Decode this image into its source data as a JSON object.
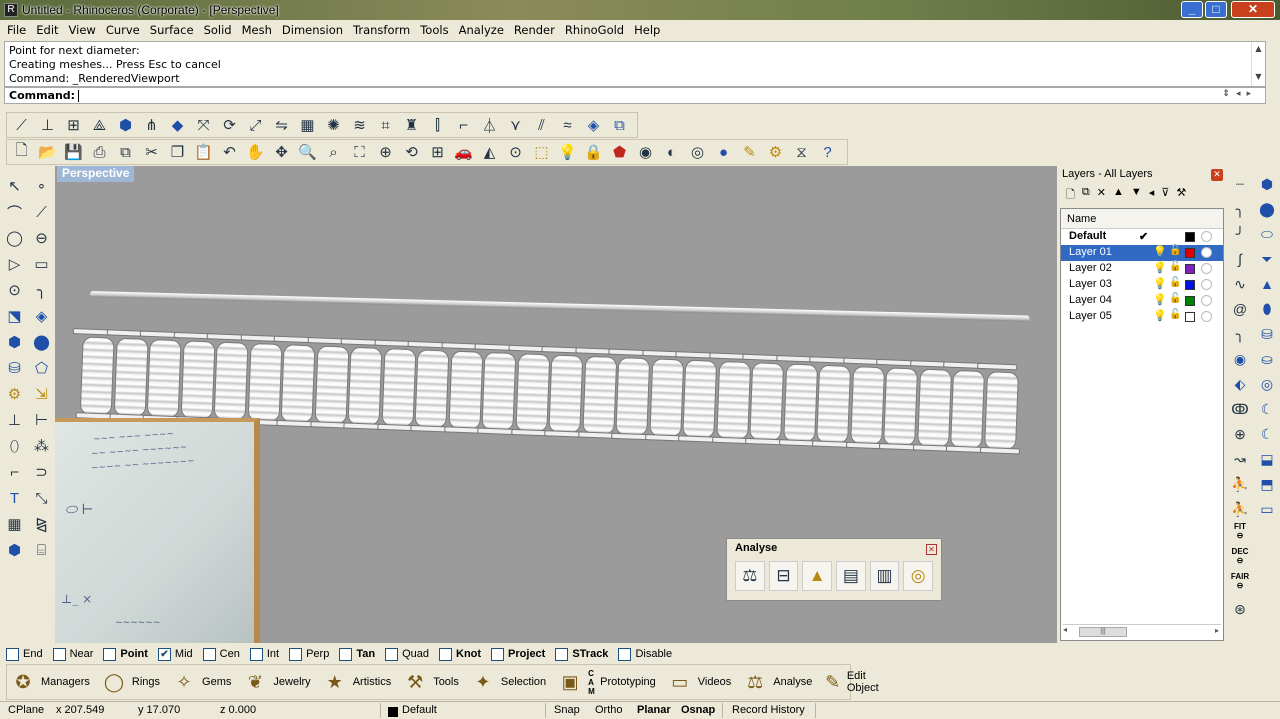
{
  "window": {
    "title": "Untitled - Rhinoceros (Corporate) - [Perspective]"
  },
  "menu": [
    "File",
    "Edit",
    "View",
    "Curve",
    "Surface",
    "Solid",
    "Mesh",
    "Dimension",
    "Transform",
    "Tools",
    "Analyze",
    "Render",
    "RhinoGold",
    "Help"
  ],
  "history": [
    "Point for next diameter:",
    "Creating meshes... Press Esc to cancel",
    "Command: _RenderedViewport"
  ],
  "command": {
    "label": "Command:",
    "value": ""
  },
  "viewport": {
    "label": "Perspective",
    "background": "#9b9b9b"
  },
  "analyse_panel": {
    "title": "Analyse",
    "icons": [
      "scale-icon",
      "weigh-icon",
      "gold-bars-icon",
      "report-icon",
      "report-save-icon",
      "measure-ring-icon"
    ]
  },
  "layers": {
    "title": "Layers - All Layers",
    "column": "Name",
    "rows": [
      {
        "name": "Default",
        "current": true,
        "color": "#000000"
      },
      {
        "name": "Layer 01",
        "selected": true,
        "color": "#e00000"
      },
      {
        "name": "Layer 02",
        "color": "#8020c0"
      },
      {
        "name": "Layer 03",
        "color": "#0010e0"
      },
      {
        "name": "Layer 04",
        "color": "#008000"
      },
      {
        "name": "Layer 05",
        "color": "#ffffff"
      }
    ]
  },
  "osnap": [
    {
      "label": "End",
      "checked": false,
      "bold": false
    },
    {
      "label": "Near",
      "checked": false,
      "bold": false
    },
    {
      "label": "Point",
      "checked": false,
      "bold": true
    },
    {
      "label": "Mid",
      "checked": true,
      "bold": false
    },
    {
      "label": "Cen",
      "checked": false,
      "bold": false
    },
    {
      "label": "Int",
      "checked": false,
      "bold": false
    },
    {
      "label": "Perp",
      "checked": false,
      "bold": false
    },
    {
      "label": "Tan",
      "checked": false,
      "bold": true
    },
    {
      "label": "Quad",
      "checked": false,
      "bold": false
    },
    {
      "label": "Knot",
      "checked": false,
      "bold": true
    },
    {
      "label": "Project",
      "checked": false,
      "bold": true
    },
    {
      "label": "STrack",
      "checked": false,
      "bold": true
    },
    {
      "label": "Disable",
      "checked": false,
      "bold": false
    }
  ],
  "tabs": [
    {
      "label": "Managers",
      "icon": "compass-icon"
    },
    {
      "label": "Rings",
      "icon": "ring-icon"
    },
    {
      "label": "Gems",
      "icon": "gem-icon"
    },
    {
      "label": "Jewelry",
      "icon": "jewelry-icon"
    },
    {
      "label": "Artistics",
      "icon": "star-icon"
    },
    {
      "label": "Tools",
      "icon": "tools-icon"
    },
    {
      "label": "Selection",
      "icon": "selection-icon"
    },
    {
      "label": "Prototyping",
      "icon": "cam-icon",
      "prefix": "C A M"
    },
    {
      "label": "Videos",
      "icon": "film-icon"
    },
    {
      "label": "Analyse",
      "icon": "scale-icon"
    },
    {
      "label": "Edit Object",
      "icon": "pencil-icon"
    }
  ],
  "status": {
    "cplane": "CPlane",
    "x": "x 207.549",
    "y": "y 17.070",
    "z": "z 0.000",
    "layer": "Default",
    "snap": "Snap",
    "ortho": "Ortho",
    "planar": "Planar",
    "osnap": "Osnap",
    "record": "Record History"
  }
}
